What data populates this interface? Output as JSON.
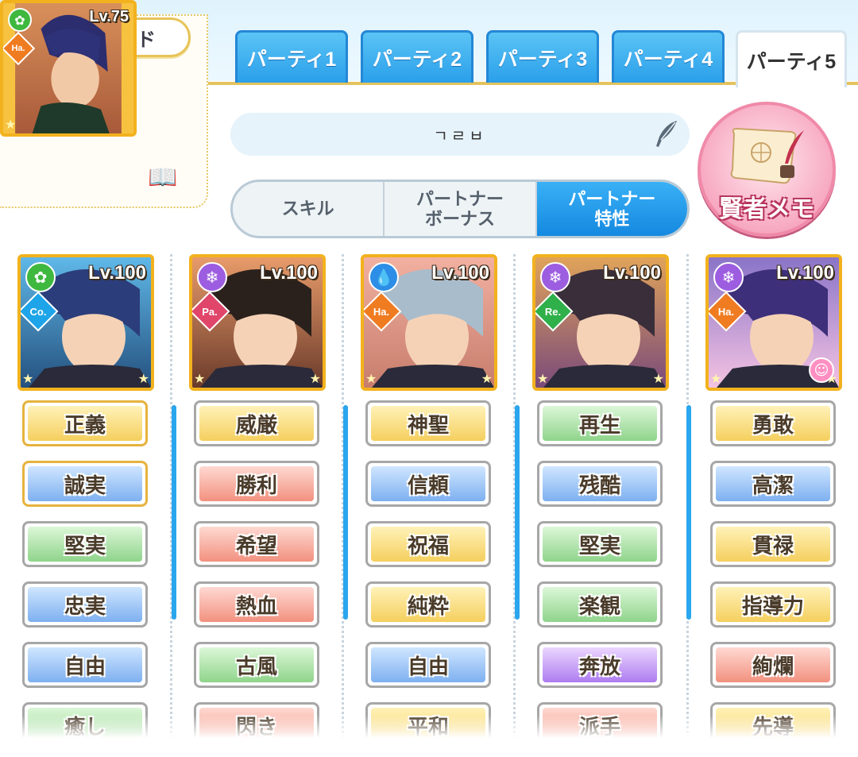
{
  "scenario": {
    "title": "シナリオカード",
    "card": {
      "level": "Lv.75",
      "attribute": "green",
      "type": "Ha."
    }
  },
  "tabs": [
    {
      "label": "パーティ1",
      "active": false
    },
    {
      "label": "パーティ2",
      "active": false
    },
    {
      "label": "パーティ3",
      "active": false
    },
    {
      "label": "パーティ4",
      "active": false
    },
    {
      "label": "パーティ5",
      "active": true
    }
  ],
  "party_name": "ㄱㄹㅂ",
  "segments": [
    {
      "label": "スキル",
      "active": false
    },
    {
      "label": "パートナー\nボーナス",
      "active": false
    },
    {
      "label": "パートナー\n特性",
      "active": true
    }
  ],
  "memo_button": {
    "label": "賢者メモ",
    "icon": "scroll-quill-icon"
  },
  "colors": {
    "accent_blue": "#2a9fea",
    "gold_border": "#e4c35d",
    "memo_pink": "#f08aa9"
  },
  "members": [
    {
      "level": "Lv.100",
      "attribute_icon": "leaf-icon",
      "attr_color": "#3fb83f",
      "type": "Co.",
      "type_color": "#1ea4e8",
      "traits": [
        {
          "label": "正義",
          "color": "yellow"
        },
        {
          "label": "誠実",
          "color": "blue"
        },
        {
          "label": "堅実",
          "color": "green"
        },
        {
          "label": "忠実",
          "color": "blue"
        },
        {
          "label": "自由",
          "color": "blue"
        },
        {
          "label": "癒し",
          "color": "green"
        }
      ]
    },
    {
      "level": "Lv.100",
      "attribute_icon": "snowflake-icon",
      "attr_color": "#9d5de0",
      "type": "Pa.",
      "type_color": "#e0456a",
      "traits": [
        {
          "label": "威厳",
          "color": "yellow"
        },
        {
          "label": "勝利",
          "color": "red"
        },
        {
          "label": "希望",
          "color": "red"
        },
        {
          "label": "熱血",
          "color": "red"
        },
        {
          "label": "古風",
          "color": "green"
        },
        {
          "label": "閃き",
          "color": "red"
        }
      ]
    },
    {
      "level": "Lv.100",
      "attribute_icon": "drop-icon",
      "attr_color": "#2c8ee6",
      "type": "Ha.",
      "type_color": "#f07c22",
      "traits": [
        {
          "label": "神聖",
          "color": "yellow"
        },
        {
          "label": "信頼",
          "color": "blue"
        },
        {
          "label": "祝福",
          "color": "yellow"
        },
        {
          "label": "純粋",
          "color": "yellow"
        },
        {
          "label": "自由",
          "color": "blue"
        },
        {
          "label": "平和",
          "color": "yellow"
        }
      ]
    },
    {
      "level": "Lv.100",
      "attribute_icon": "snowflake-icon",
      "attr_color": "#9d5de0",
      "type": "Re.",
      "type_color": "#2fb04a",
      "traits": [
        {
          "label": "再生",
          "color": "green"
        },
        {
          "label": "残酷",
          "color": "blue"
        },
        {
          "label": "堅実",
          "color": "green"
        },
        {
          "label": "楽観",
          "color": "green"
        },
        {
          "label": "奔放",
          "color": "purple"
        },
        {
          "label": "派手",
          "color": "red"
        }
      ]
    },
    {
      "level": "Lv.100",
      "attribute_icon": "snowflake-icon",
      "attr_color": "#9d5de0",
      "type": "Ha.",
      "type_color": "#f07c22",
      "traits": [
        {
          "label": "勇敢",
          "color": "yellow"
        },
        {
          "label": "高潔",
          "color": "blue"
        },
        {
          "label": "貫禄",
          "color": "yellow"
        },
        {
          "label": "指導力",
          "color": "yellow"
        },
        {
          "label": "絢爛",
          "color": "red"
        },
        {
          "label": "先導",
          "color": "yellow"
        }
      ]
    }
  ]
}
